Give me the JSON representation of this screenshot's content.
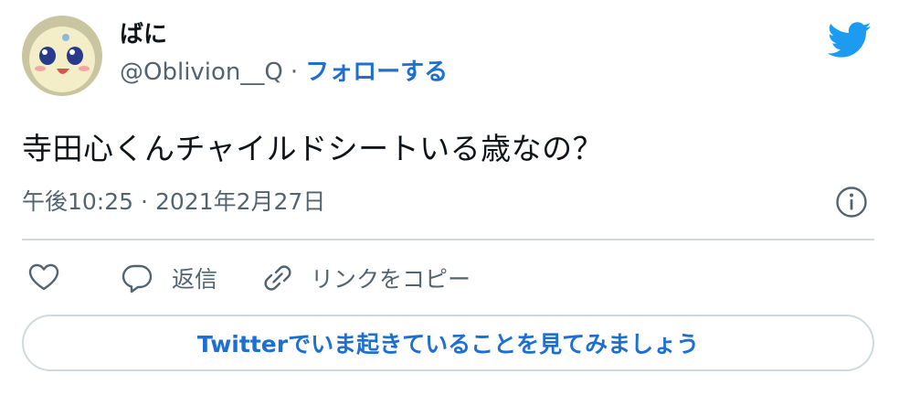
{
  "user": {
    "display_name": "ばに",
    "handle": "@Oblivion__Q",
    "separator": "·",
    "follow_label": "フォローする"
  },
  "tweet": {
    "text": "寺田心くんチャイルドシートいる歳なの？",
    "time": "午後10:25",
    "separator": "·",
    "date": "2021年2月27日"
  },
  "actions": {
    "reply_label": "返信",
    "copy_link_label": "リンクをコピー"
  },
  "cta": {
    "label": "Twitterでいま起きていることを見てみましょう"
  },
  "icons": {
    "brand": "twitter-bird-icon",
    "info": "info-icon",
    "like": "heart-icon",
    "reply": "speech-bubble-icon",
    "link": "link-icon"
  },
  "colors": {
    "brand_blue": "#1d9bf0",
    "link_blue": "#1d6fd1",
    "text_primary": "#0f1419",
    "text_secondary": "#536471",
    "divider": "#cfd9de"
  }
}
